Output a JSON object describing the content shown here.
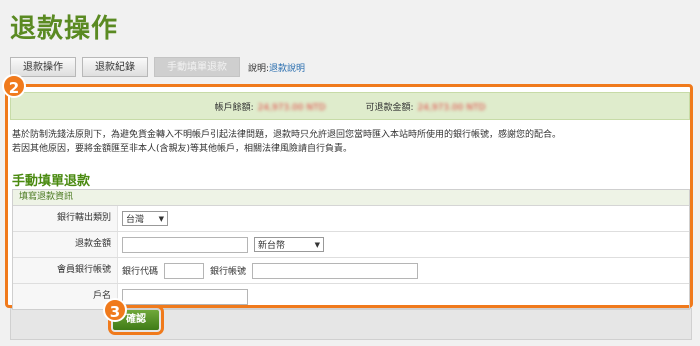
{
  "page": {
    "title": "退款操作"
  },
  "tabs": [
    {
      "label": "退款操作"
    },
    {
      "label": "退款紀錄"
    },
    {
      "label": "手動填單退款"
    }
  ],
  "help": {
    "prefix": "說明:",
    "link": "退款說明"
  },
  "balances": {
    "account_label": "帳戶餘額:",
    "account_value": "24,973.00 NTD",
    "refundable_label": "可退款金額:",
    "refundable_value": "24,973.00 NTD"
  },
  "notice": {
    "line1": "基於防制洗錢法原則下，為避免貨金轉入不明帳戶引起法律問題，退款時只允許退回您當時匯入本站時所使用的銀行帳號，感謝您的配合。",
    "line2": "若因其他原因，要將金額匯至非本人(含親友)等其他帳戶，相關法律風險請自行負責。"
  },
  "section": {
    "title": "手動填單退款"
  },
  "form": {
    "header": "填寫退款資訊",
    "bank_category_label": "銀行轄出類別",
    "bank_category_value": "台灣",
    "amount_label": "退款金額",
    "currency_value": "新台幣",
    "member_account_label": "會員銀行帳號",
    "bank_code_label": "銀行代碼",
    "bank_account_label": "銀行帳號",
    "account_name_label": "戶名"
  },
  "confirm_label": "確認",
  "badges": {
    "panel": "2",
    "confirm": "3"
  }
}
